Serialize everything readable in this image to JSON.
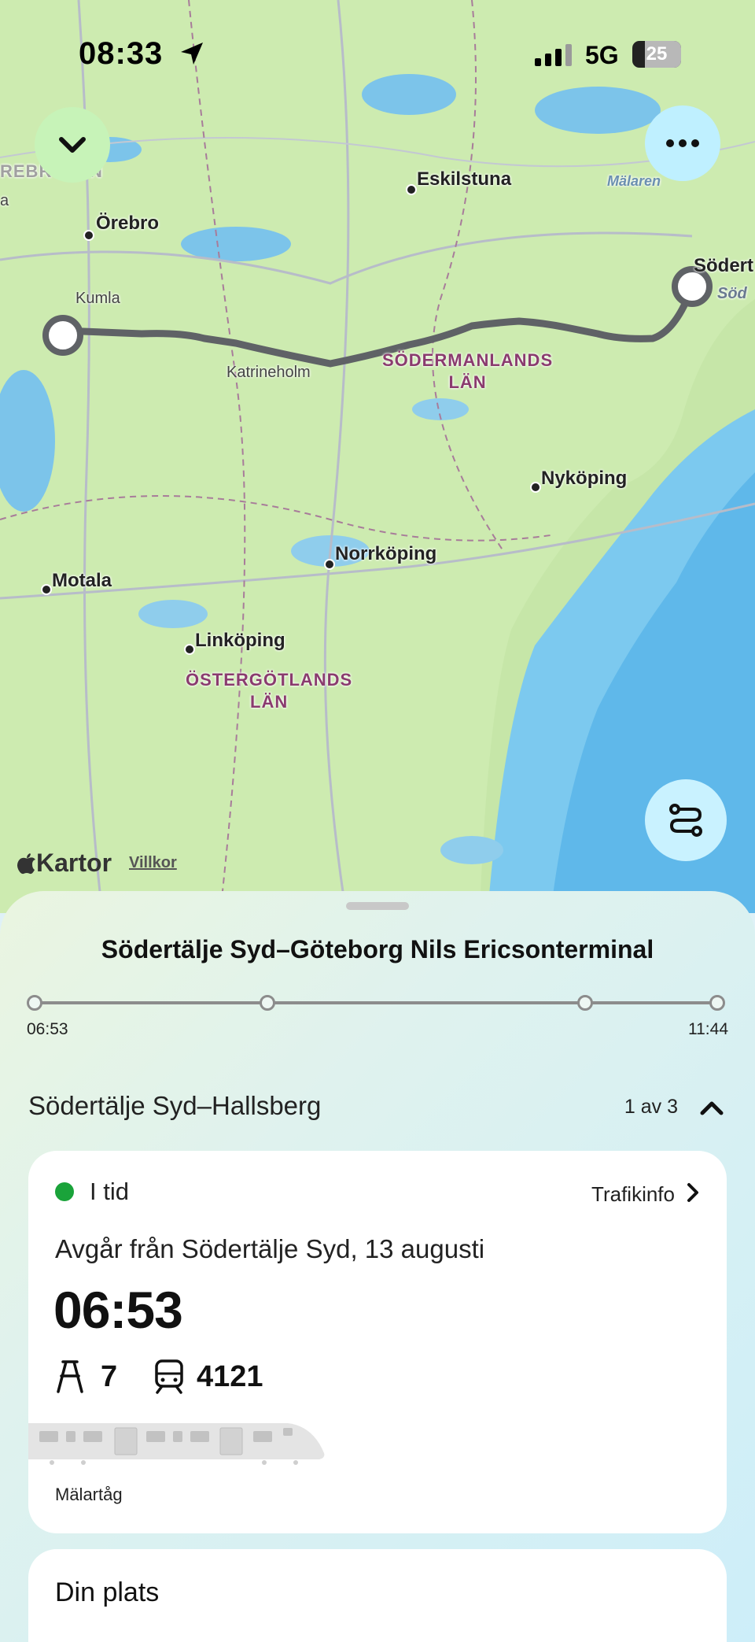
{
  "status_bar": {
    "time": "08:33",
    "network": "5G",
    "battery": "25"
  },
  "map": {
    "labels": {
      "orebro": "Örebro",
      "kumla": "Kumla",
      "eskilstuna": "Eskilstuna",
      "malaren": "Mälaren",
      "sodertalje": "Södert",
      "sodertalje_partial": "Söd",
      "katrineholm": "Katrineholm",
      "sodermanland_line1": "SÖDERMANLANDS",
      "sodermanland_line2": "LÄN",
      "nykoping": "Nyköping",
      "norrkoping": "Norrköping",
      "motala": "Motala",
      "linkoping": "Linköping",
      "ostergotland_line1": "ÖSTERGÖTLANDS",
      "ostergotland_line2": "LÄN",
      "orebro_region": "REBRO",
      "orebro_region_end": "N",
      "edge_a": "a"
    },
    "attribution": {
      "brand": "Kartor",
      "terms": "Villkor"
    }
  },
  "sheet": {
    "title": "Södertälje Syd–Göteborg Nils Ericsonterminal",
    "timeline": {
      "start_time": "06:53",
      "end_time": "11:44"
    },
    "leg": {
      "title": "Södertälje Syd–Hallsberg",
      "count": "1 av 3"
    },
    "card": {
      "status": "I tid",
      "status_color": "#1aa33a",
      "trafikinfo": "Trafikinfo",
      "departure": "Avgår från Södertälje Syd, 13 augusti",
      "time": "06:53",
      "track": "7",
      "train_number": "4121",
      "train_type": "Mälartåg"
    },
    "location_card": {
      "title": "Din plats"
    }
  }
}
